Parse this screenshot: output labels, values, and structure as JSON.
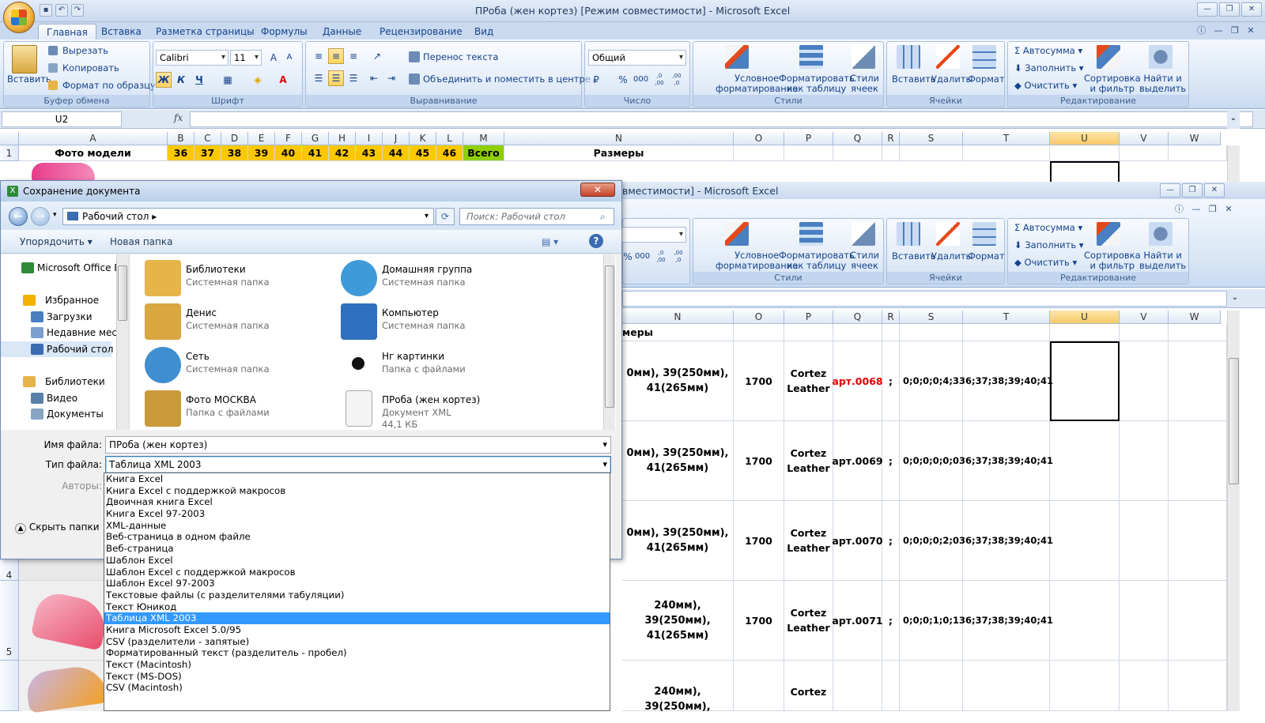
{
  "window": {
    "title": "ПРоба (жен кортез)  [Режим совместимости] - Microsoft Excel",
    "title2": "вместимости] - Microsoft Excel"
  },
  "tabs": [
    "Главная",
    "Вставка",
    "Разметка страницы",
    "Формулы",
    "Данные",
    "Рецензирование",
    "Вид"
  ],
  "ribbon": {
    "clipboard": {
      "paste": "Вставить",
      "cut": "Вырезать",
      "copy": "Копировать",
      "format_painter": "Формат по образцу",
      "label": "Буфер обмена"
    },
    "font": {
      "name": "Calibri",
      "size": "11",
      "label": "Шрифт",
      "bold": "Ж",
      "italic": "К",
      "underline": "Ч"
    },
    "alignment": {
      "wrap": "Перенос текста",
      "merge": "Объединить и поместить в центре",
      "label": "Выравнивание"
    },
    "number": {
      "format": "Общий",
      "label": "Число",
      "percent": "%",
      "thousands": "000",
      "inc": ",0 ,00",
      "dec": ",00 ,0"
    },
    "styles": {
      "conditional": [
        "Условное",
        "форматирование"
      ],
      "as_table": [
        "Форматировать",
        "как таблицу"
      ],
      "cell_styles": [
        "Стили",
        "ячеек"
      ],
      "label": "Стили"
    },
    "cells": {
      "insert": "Вставить",
      "delete": "Удалить",
      "format": "Формат",
      "label": "Ячейки"
    },
    "editing": {
      "autosum": "Автосумма",
      "fill": "Заполнить",
      "clear": "Очистить",
      "sort": [
        "Сортировка",
        "и фильтр"
      ],
      "find": [
        "Найти и",
        "выделить"
      ],
      "label": "Редактирование"
    }
  },
  "formula_bar": {
    "name_box": "U2",
    "fx": "fx"
  },
  "columns": {
    "left": [
      "A",
      "B",
      "C",
      "D",
      "E",
      "F",
      "G",
      "H",
      "I",
      "J",
      "K",
      "L",
      "M",
      "N"
    ],
    "right": [
      "O",
      "P",
      "Q",
      "R",
      "S",
      "T",
      "U",
      "V",
      "W"
    ]
  },
  "row1": {
    "A": "Фото модели",
    "sizes": [
      "36",
      "37",
      "38",
      "39",
      "40",
      "41",
      "42",
      "43",
      "44",
      "45",
      "46"
    ],
    "total": "Всего",
    "N": "Размеры"
  },
  "row_numbers": [
    "1",
    "4",
    "5"
  ],
  "lower_grid": {
    "n_header": "меры",
    "rows": [
      {
        "n1": "0мм), 39(250мм),",
        "n2": "41(265мм)",
        "price": "1700",
        "model1": "Cortez",
        "model2": "Leather",
        "art": "арт.0068",
        "semi": ";",
        "s": "0;0;0;0;4;3",
        "t": "36;37;38;39;40;41"
      },
      {
        "n1": "0мм), 39(250мм),",
        "n2": "41(265мм)",
        "price": "1700",
        "model1": "Cortez",
        "model2": "Leather",
        "art": "арт.0069",
        "semi": ";",
        "s": "0;0;0;0;0;0",
        "t": "36;37;38;39;40;41"
      },
      {
        "n1": "0мм), 39(250мм),",
        "n2": "41(265мм)",
        "price": "1700",
        "model1": "Cortez",
        "model2": "Leather",
        "art": "арт.0070",
        "semi": ";",
        "s": "0;0;0;0;2;0",
        "t": "36;37;38;39;40;41"
      },
      {
        "n1": "240мм), 39(250мм),",
        "n2": "41(265мм)",
        "price": "1700",
        "model1": "Cortez",
        "model2": "Leather",
        "art": "арт.0071",
        "semi": ";",
        "s": "0;0;0;1;0;1",
        "t": "36;37;38;39;40;41"
      },
      {
        "n1": "240мм), 39(250мм),",
        "n2": "",
        "price": "",
        "model1": "Cortez",
        "model2": "",
        "art": "",
        "semi": "",
        "s": "",
        "t": ""
      }
    ]
  },
  "dialog": {
    "title": "Сохранение документа",
    "close": "✕",
    "address": "Рабочий стол",
    "search_placeholder": "Поиск: Рабочий стол",
    "organize": "Упорядочить",
    "new_folder": "Новая папка",
    "help": "?",
    "nav": [
      {
        "label": "Microsoft Office Ex",
        "color": "#2e8b3a"
      },
      {
        "label": "Избранное",
        "color": "#f2b200"
      },
      {
        "label": "Загрузки",
        "color": "#4a7fc1"
      },
      {
        "label": "Недавние места",
        "color": "#7aa0cf"
      },
      {
        "label": "Рабочий стол",
        "color": "#3b6bb0"
      },
      {
        "label": "Библиотеки",
        "color": "#e6b44a"
      },
      {
        "label": "Видео",
        "color": "#5a7fa8"
      },
      {
        "label": "Документы",
        "color": "#8aa5c4"
      }
    ],
    "files": [
      {
        "name": "Библиотеки",
        "sub": "Системная папка",
        "size": "",
        "color": "#e6b44a"
      },
      {
        "name": "Домашняя группа",
        "sub": "Системная папка",
        "size": "",
        "color": "#3f9ad9"
      },
      {
        "name": "Денис",
        "sub": "Системная папка",
        "size": "",
        "color": "#d9a640"
      },
      {
        "name": "Компьютер",
        "sub": "Системная папка",
        "size": "",
        "color": "#2f6fc0"
      },
      {
        "name": "Сеть",
        "sub": "Системная папка",
        "size": "",
        "color": "#3f8ecf"
      },
      {
        "name": "Нг картинки",
        "sub": "Папка с файлами",
        "size": "",
        "color": "#111111"
      },
      {
        "name": "Фото МОСКВА",
        "sub": "Папка с файлами",
        "size": "",
        "color": "#c99a3a"
      },
      {
        "name": "ПРоба (жен кортез)",
        "sub": "Документ XML",
        "size": "44,1 КБ",
        "color": "#f4f4f4"
      }
    ],
    "filename_label": "Имя файла:",
    "filename": "ПРоба (жен кортез)",
    "filetype_label": "Тип файла:",
    "filetype": "Таблица XML 2003",
    "authors_label": "Авторы:",
    "hide_folders": "Скрыть папки",
    "types": [
      "Книга Excel",
      "Книга Excel с поддержкой макросов",
      "Двоичная книга Excel",
      "Книга Excel 97-2003",
      "XML-данные",
      "Веб-страница в одном файле",
      "Веб-страница",
      "Шаблон Excel",
      "Шаблон Excel с поддержкой макросов",
      "Шаблон Excel 97-2003",
      "Текстовые файлы (с разделителями табуляции)",
      "Текст Юникод",
      "Таблица XML 2003",
      "Книга Microsoft Excel 5.0/95",
      "CSV (разделители - запятые)",
      "Форматированный текст (разделитель - пробел)",
      "Текст (Macintosh)",
      "Текст (MS-DOS)",
      "CSV (Macintosh)"
    ],
    "selected_type_index": 12
  },
  "colors": {
    "yellow": "#fcc800",
    "green": "#8fce00",
    "red_art": "#e00000",
    "selection": "#3399ff"
  }
}
